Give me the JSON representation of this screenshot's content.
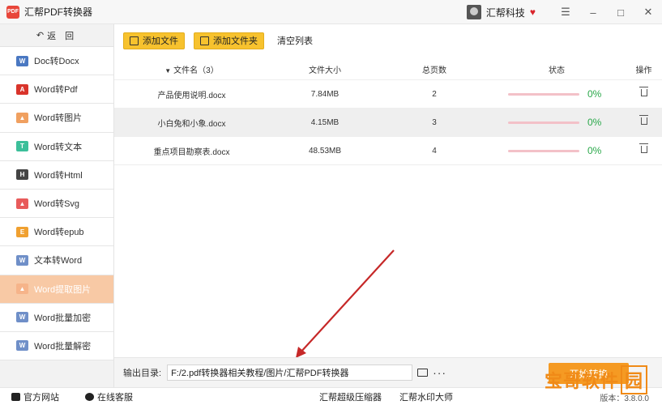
{
  "window": {
    "logo_text": "PDF",
    "title": "汇帮PDF转换器",
    "user": "汇帮科技",
    "controls": [
      "☰",
      "–",
      "□",
      "✕"
    ]
  },
  "sidebar": {
    "back_label": "返 回",
    "items": [
      {
        "label": "Doc转Docx",
        "icon": "word-icon",
        "color": "#4a78c2",
        "glyph": "W"
      },
      {
        "label": "Word转Pdf",
        "icon": "pdf-icon",
        "color": "#d9342b",
        "glyph": "A"
      },
      {
        "label": "Word转图片",
        "icon": "image-icon",
        "color": "#f0a060",
        "glyph": "▲"
      },
      {
        "label": "Word转文本",
        "icon": "text-icon",
        "color": "#3cbf9a",
        "glyph": "T"
      },
      {
        "label": "Word转Html",
        "icon": "html-icon",
        "color": "#444444",
        "glyph": "H"
      },
      {
        "label": "Word转Svg",
        "icon": "svg-icon",
        "color": "#e85b5b",
        "glyph": "▲"
      },
      {
        "label": "Word转epub",
        "icon": "epub-icon",
        "color": "#f0a030",
        "glyph": "E"
      },
      {
        "label": "文本转Word",
        "icon": "word-icon",
        "color": "#6f8fc8",
        "glyph": "W"
      },
      {
        "label": "Word提取图片",
        "icon": "image-icon",
        "color": "#f6b48a",
        "glyph": "▲",
        "active": true
      },
      {
        "label": "Word批量加密",
        "icon": "word-lock-icon",
        "color": "#6f8fc8",
        "glyph": "W"
      },
      {
        "label": "Word批量解密",
        "icon": "word-unlock-icon",
        "color": "#6f8fc8",
        "glyph": "W"
      }
    ]
  },
  "toolbar": {
    "add_file": "添加文件",
    "add_folder": "添加文件夹",
    "clear_list": "清空列表"
  },
  "table": {
    "headers": {
      "name": "文件名（3）",
      "size": "文件大小",
      "pages": "总页数",
      "status": "状态",
      "op": "操作"
    },
    "rows": [
      {
        "name": "产品使用说明.docx",
        "size": "7.84MB",
        "pages": "2",
        "progress": "0%"
      },
      {
        "name": "小白兔和小象.docx",
        "size": "4.15MB",
        "pages": "3",
        "progress": "0%"
      },
      {
        "name": "重点项目勘察表.docx",
        "size": "48.53MB",
        "pages": "4",
        "progress": "0%"
      }
    ]
  },
  "output": {
    "label": "输出目录:",
    "path": "F:/2.pdf转换器相关教程/图片/汇帮PDF转换器",
    "more": "···",
    "convert": "开始转换"
  },
  "footer": {
    "website": "官方网站",
    "support": "在线客服",
    "compressor": "汇帮超级压缩器",
    "watermark_app": "汇帮水印大师",
    "version": "版本：3.8.0.0"
  },
  "overlay_watermark": {
    "text": "宝哥软件",
    "boxed": "园"
  },
  "colors": {
    "accent_yellow": "#f7c22e",
    "active_nav": "#f8c9a5",
    "progress_green": "#2aa84a",
    "convert_orange": "#f59a23",
    "annotation_arrow": "#c62828"
  }
}
